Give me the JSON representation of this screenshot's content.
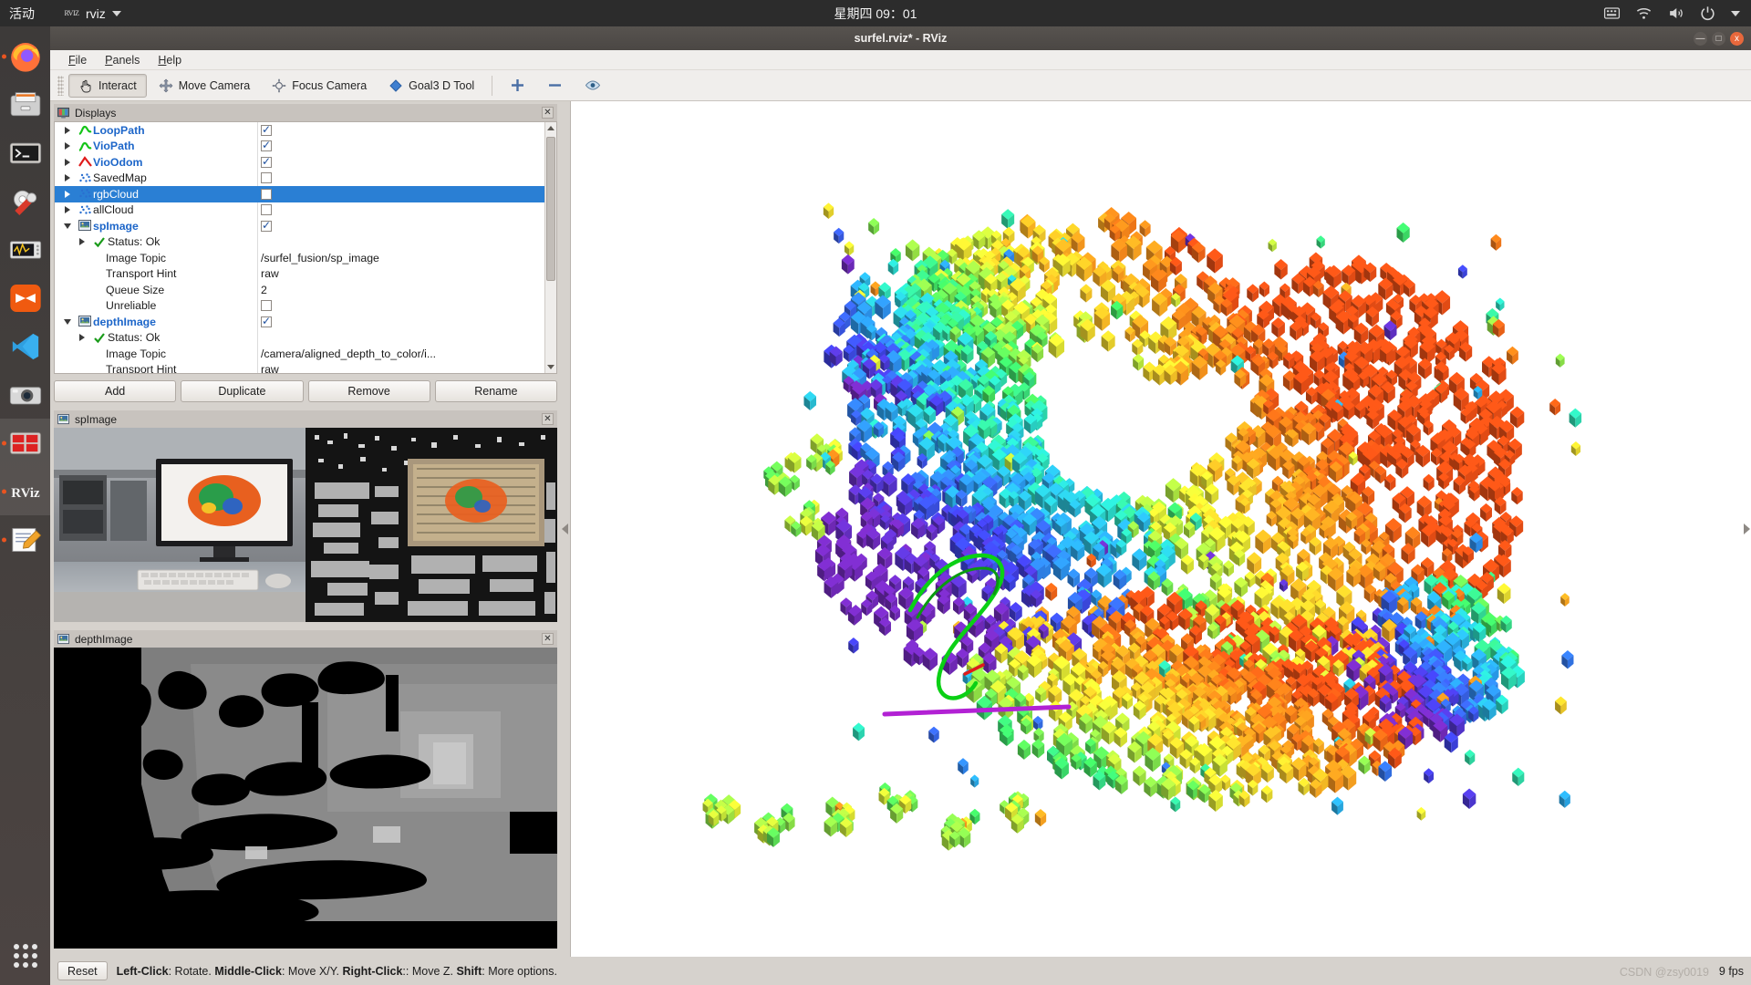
{
  "desktop": {
    "activities": "活动",
    "app_menu": "rviz",
    "app_menu_icon": "rviz-small-icon",
    "clock": "星期四 09：01",
    "tray": [
      "keyboard-layout-icon",
      "wifi-icon",
      "volume-icon",
      "power-icon",
      "chevron-down-icon"
    ],
    "dock": [
      {
        "name": "firefox",
        "running": true
      },
      {
        "name": "files",
        "running": false
      },
      {
        "name": "terminal",
        "running": false
      },
      {
        "name": "settings-tools",
        "running": false
      },
      {
        "name": "system-monitor",
        "running": false
      },
      {
        "name": "media-player",
        "running": false
      },
      {
        "name": "vscode",
        "running": false
      },
      {
        "name": "camera",
        "running": false
      },
      {
        "name": "screen-recorder",
        "running": true
      },
      {
        "name": "rviz",
        "running": true
      },
      {
        "name": "text-editor",
        "running": true
      }
    ],
    "show_apps": "show-applications"
  },
  "window": {
    "title": "surfel.rviz* - RViz",
    "buttons": {
      "minimize": "—",
      "maximize": "□",
      "close": "x"
    }
  },
  "menubar": [
    {
      "label": "File",
      "mnemonic": "F"
    },
    {
      "label": "Panels",
      "mnemonic": "P"
    },
    {
      "label": "Help",
      "mnemonic": "H"
    }
  ],
  "toolbar": [
    {
      "label": "Interact",
      "icon": "hand-cursor-icon",
      "pressed": true
    },
    {
      "label": "Move Camera",
      "icon": "move-camera-icon",
      "pressed": false
    },
    {
      "label": "Focus Camera",
      "icon": "focus-camera-icon",
      "pressed": false
    },
    {
      "label": "Goal3 D Tool",
      "icon": "goal-diamond-icon",
      "pressed": false
    },
    {
      "label": "",
      "icon": "plus-icon",
      "pressed": false
    },
    {
      "label": "",
      "icon": "minus-icon",
      "pressed": false
    },
    {
      "label": "",
      "icon": "eye-icon",
      "pressed": false
    }
  ],
  "displays_panel": {
    "title": "Displays",
    "icon": "displays-monitor-icon",
    "close_label": "✕",
    "rows": [
      {
        "indent": 0,
        "arrow": "right",
        "icon": "path-curve-green-icon",
        "label": "LoopPath",
        "style": "blue",
        "value_type": "checkbox",
        "checked": true
      },
      {
        "indent": 0,
        "arrow": "right",
        "icon": "path-curve-green-icon",
        "label": "VioPath",
        "style": "blue",
        "value_type": "checkbox",
        "checked": true
      },
      {
        "indent": 0,
        "arrow": "right",
        "icon": "odom-arrow-red-icon",
        "label": "VioOdom",
        "style": "blue",
        "value_type": "checkbox",
        "checked": true
      },
      {
        "indent": 0,
        "arrow": "right",
        "icon": "pointcloud-icon",
        "label": "SavedMap",
        "style": "plain",
        "value_type": "checkbox",
        "checked": false
      },
      {
        "indent": 0,
        "arrow": "right",
        "icon": "pointcloud-icon",
        "label": "rgbCloud",
        "style": "plain",
        "value_type": "checkbox",
        "checked": false,
        "selected": true
      },
      {
        "indent": 0,
        "arrow": "right",
        "icon": "pointcloud-icon",
        "label": "allCloud",
        "style": "plain",
        "value_type": "checkbox",
        "checked": false
      },
      {
        "indent": 0,
        "arrow": "down",
        "icon": "image-display-icon",
        "label": "spImage",
        "style": "blue",
        "value_type": "checkbox",
        "checked": true
      },
      {
        "indent": 1,
        "arrow": "right",
        "icon": "status-ok-check-icon",
        "label": "Status: Ok",
        "style": "plain",
        "value_type": "none"
      },
      {
        "indent": 2,
        "arrow": "none",
        "icon": "none",
        "label": "Image Topic",
        "style": "plain",
        "value_type": "text",
        "value": "/surfel_fusion/sp_image"
      },
      {
        "indent": 2,
        "arrow": "none",
        "icon": "none",
        "label": "Transport Hint",
        "style": "plain",
        "value_type": "text",
        "value": "raw"
      },
      {
        "indent": 2,
        "arrow": "none",
        "icon": "none",
        "label": "Queue Size",
        "style": "plain",
        "value_type": "text",
        "value": "2"
      },
      {
        "indent": 2,
        "arrow": "none",
        "icon": "none",
        "label": "Unreliable",
        "style": "plain",
        "value_type": "checkbox",
        "checked": false
      },
      {
        "indent": 0,
        "arrow": "down",
        "icon": "image-display-icon",
        "label": "depthImage",
        "style": "blue",
        "value_type": "checkbox",
        "checked": true
      },
      {
        "indent": 1,
        "arrow": "right",
        "icon": "status-ok-check-icon",
        "label": "Status: Ok",
        "style": "plain",
        "value_type": "none"
      },
      {
        "indent": 2,
        "arrow": "none",
        "icon": "none",
        "label": "Image Topic",
        "style": "plain",
        "value_type": "text",
        "value": "/camera/aligned_depth_to_color/i..."
      },
      {
        "indent": 2,
        "arrow": "none",
        "icon": "none",
        "label": "Transport Hint",
        "style": "plain",
        "value_type": "text",
        "value": "raw"
      }
    ],
    "buttons": [
      {
        "label": "Add"
      },
      {
        "label": "Duplicate"
      },
      {
        "label": "Remove"
      },
      {
        "label": "Rename"
      }
    ]
  },
  "sp_image_panel": {
    "title": "spImage",
    "icon": "image-display-icon",
    "close_label": "✕"
  },
  "depth_image_panel": {
    "title": "depthImage",
    "icon": "image-display-icon",
    "close_label": "✕"
  },
  "statusbar": {
    "reset_label": "Reset",
    "hint_parts": [
      {
        "text": "Left-Click",
        "bold": true
      },
      {
        "text": ": Rotate. ",
        "bold": false
      },
      {
        "text": "Middle-Click",
        "bold": true
      },
      {
        "text": ": Move X/Y. ",
        "bold": false
      },
      {
        "text": "Right-Click",
        "bold": true
      },
      {
        "text": ":: Move Z. ",
        "bold": false
      },
      {
        "text": "Shift",
        "bold": true
      },
      {
        "text": ": More options.",
        "bold": false
      }
    ],
    "fps": "9 fps",
    "watermark": "CSDN @zsy0019"
  },
  "colors": {
    "accent": "#2a7fd4",
    "blue_label": "#1d66c9",
    "ubuntu_orange": "#e95420",
    "panel_bg": "#d6d2cd",
    "view_bg": "#ffffff"
  }
}
